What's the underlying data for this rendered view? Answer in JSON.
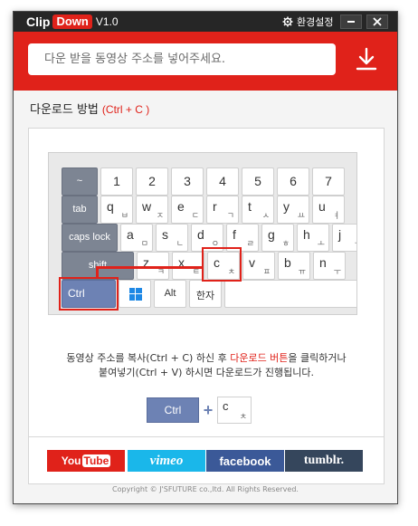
{
  "titlebar": {
    "brand_clip": "Clip",
    "brand_down": "Down",
    "version": "V1.0",
    "settings_label": "환경설정",
    "min_label": "–",
    "close_label": "✕"
  },
  "url_bar": {
    "placeholder": "다운 받을 동영상 주소를 넣어주세요.",
    "value": ""
  },
  "howto": {
    "title": "다운로드 방법",
    "hint": "(Ctrl + C )"
  },
  "keyboard": {
    "row1": [
      {
        "main": "~"
      },
      {
        "main": "1"
      },
      {
        "main": "2"
      },
      {
        "main": "3"
      },
      {
        "main": "4"
      },
      {
        "main": "5"
      },
      {
        "main": "6"
      },
      {
        "main": "7"
      }
    ],
    "row2": [
      {
        "main": "tab"
      },
      {
        "main": "q",
        "sub": "ㅂ"
      },
      {
        "main": "w",
        "sub": "ㅈ"
      },
      {
        "main": "e",
        "sub": "ㄷ"
      },
      {
        "main": "r",
        "sub": "ㄱ"
      },
      {
        "main": "t",
        "sub": "ㅅ"
      },
      {
        "main": "y",
        "sub": "ㅛ"
      },
      {
        "main": "u",
        "sub": "ㅕ"
      }
    ],
    "row3": [
      {
        "main": "caps lock"
      },
      {
        "main": "a",
        "sub": "ㅁ"
      },
      {
        "main": "s",
        "sub": "ㄴ"
      },
      {
        "main": "d",
        "sub": "ㅇ"
      },
      {
        "main": "f",
        "sub": "ㄹ"
      },
      {
        "main": "g",
        "sub": "ㅎ"
      },
      {
        "main": "h",
        "sub": "ㅗ"
      },
      {
        "main": "j",
        "sub": "ㅓ"
      }
    ],
    "row4": [
      {
        "main": "shift"
      },
      {
        "main": "z",
        "sub": "ㅋ"
      },
      {
        "main": "x",
        "sub": "ㅌ"
      },
      {
        "main": "c",
        "sub": "ㅊ"
      },
      {
        "main": "v",
        "sub": "ㅍ"
      },
      {
        "main": "b",
        "sub": "ㅠ"
      },
      {
        "main": "n",
        "sub": "ㅜ"
      }
    ],
    "row5": [
      {
        "main": "Ctrl"
      },
      {
        "main": ""
      },
      {
        "main": "Alt"
      },
      {
        "main": "한자"
      }
    ]
  },
  "instructions": {
    "line1_a": "동영상 주소를 복사(Ctrl + C) 하신 후 ",
    "line1_red": "다운로드 버튼",
    "line1_b": "을 클릭하거나",
    "line2": "붙여넣기(Ctrl + V) 하시면 다운로드가 진행됩니다."
  },
  "combo": {
    "ctrl": "Ctrl",
    "plus": "+",
    "c_main": "c",
    "c_sub": "ㅊ"
  },
  "sites": {
    "youtube_you": "You",
    "youtube_tube": "Tube",
    "vimeo": "vimeo",
    "facebook": "facebook",
    "tumblr": "tumblr."
  },
  "copyright": "Copyright © J'SFUTURE co.,ltd. All Rights Reserved.",
  "colors": {
    "accent_red": "#e0221a",
    "titlebar": "#262626",
    "ctrl_key": "#6d82b4",
    "dark_key": "#7d8593",
    "youtube": "#e0221a",
    "vimeo": "#1ab7ea",
    "facebook": "#3b5998",
    "tumblr": "#35465c"
  }
}
